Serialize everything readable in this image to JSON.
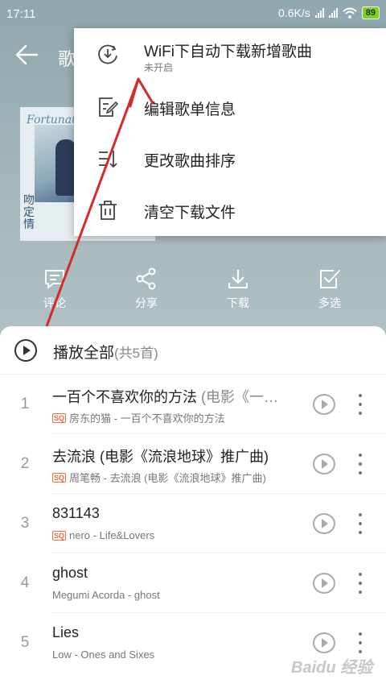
{
  "status": {
    "time": "17:11",
    "speed": "0.6K/s",
    "battery": "89"
  },
  "header": {
    "title": "歌"
  },
  "cover": {
    "script_text": "Fortunately",
    "vertical_text": "吻定情"
  },
  "actions": [
    {
      "label": "评论",
      "icon": "comment-icon"
    },
    {
      "label": "分享",
      "icon": "share-icon"
    },
    {
      "label": "下载",
      "icon": "download-icon"
    },
    {
      "label": "多选",
      "icon": "multiselect-icon"
    }
  ],
  "play_all": {
    "label": "播放全部",
    "count": "(共5首)"
  },
  "songs": [
    {
      "num": "1",
      "title": "一百个不喜欢你的方法",
      "title_extra": " (电影《一…",
      "sq": true,
      "subtitle": "房东的猫 - 一百个不喜欢你的方法"
    },
    {
      "num": "2",
      "title": "去流浪 (电影《流浪地球》推广曲)",
      "title_extra": "",
      "sq": true,
      "subtitle": "周笔畅 - 去流浪 (电影《流浪地球》推广曲)"
    },
    {
      "num": "3",
      "title": "831143",
      "title_extra": "",
      "sq": true,
      "subtitle": "nero - Life&Lovers"
    },
    {
      "num": "4",
      "title": "ghost",
      "title_extra": "",
      "sq": false,
      "subtitle": "Megumi Acorda - ghost"
    },
    {
      "num": "5",
      "title": "Lies",
      "title_extra": "",
      "sq": false,
      "subtitle": "Low - Ones and Sixes"
    }
  ],
  "sq_badge": "SQ",
  "menu": {
    "items": [
      {
        "label": "WiFi下自动下载新增歌曲",
        "sub": "未开启",
        "icon": "wifi-download-icon"
      },
      {
        "label": "编辑歌单信息",
        "sub": "",
        "icon": "edit-icon"
      },
      {
        "label": "更改歌曲排序",
        "sub": "",
        "icon": "sort-icon"
      },
      {
        "label": "清空下载文件",
        "sub": "",
        "icon": "trash-icon"
      }
    ]
  },
  "annotation": {
    "arrow_color": "#d42a2a"
  },
  "watermark": "Baidu 经验"
}
